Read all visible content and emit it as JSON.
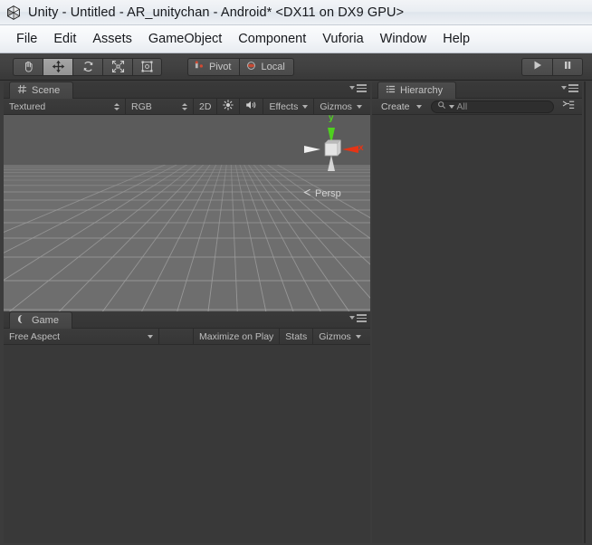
{
  "window": {
    "title": "Unity - Untitled - AR_unitychan - Android* <DX11 on DX9 GPU>",
    "logo_icon": "unity-logo-icon"
  },
  "menubar": {
    "items": [
      {
        "label": "File"
      },
      {
        "label": "Edit"
      },
      {
        "label": "Assets"
      },
      {
        "label": "GameObject"
      },
      {
        "label": "Component"
      },
      {
        "label": "Vuforia"
      },
      {
        "label": "Window"
      },
      {
        "label": "Help"
      }
    ]
  },
  "toolbar": {
    "transform_tools": [
      {
        "name": "hand-tool",
        "icon": "hand-icon",
        "active": false
      },
      {
        "name": "move-tool",
        "icon": "move-arrows-icon",
        "active": true
      },
      {
        "name": "rotate-tool",
        "icon": "rotate-icon",
        "active": false
      },
      {
        "name": "scale-tool",
        "icon": "scale-icon",
        "active": false
      },
      {
        "name": "rect-tool",
        "icon": "rect-transform-icon",
        "active": false
      }
    ],
    "pivot_label": "Pivot",
    "pivot_icon": "pivot-icon",
    "local_label": "Local",
    "local_icon": "local-rotation-icon",
    "play_icon": "play-icon",
    "pause_icon": "pause-icon"
  },
  "scene_panel": {
    "tab_label": "Scene",
    "tab_icon": "scene-grid-icon",
    "menu_icon": "panel-options-icon",
    "toolbar": {
      "draw_mode": "Textured",
      "render_mode": "RGB",
      "toggle_2d": "2D",
      "lighting_icon": "sun-light-icon",
      "audio_icon": "audio-speaker-icon",
      "effects_label": "Effects",
      "gizmos_label": "Gizmos"
    },
    "viewport": {
      "axis_gizmo": {
        "y_label": "y",
        "x_label": "x",
        "y_color": "#4fd01f",
        "x_color": "#e53415",
        "center_color": "#e4e4e4"
      },
      "projection_label": "Persp",
      "sky_color": "#5b5b5b",
      "ground_color": "#6e6e6e",
      "grid_color": "#8a8a8a"
    }
  },
  "game_panel": {
    "tab_label": "Game",
    "tab_icon": "game-view-icon",
    "menu_icon": "panel-options-icon",
    "toolbar": {
      "aspect": "Free Aspect",
      "maximize_label": "Maximize on Play",
      "stats_label": "Stats",
      "gizmos_label": "Gizmos"
    }
  },
  "hierarchy_panel": {
    "tab_label": "Hierarchy",
    "tab_icon": "hierarchy-list-icon",
    "menu_icon": "panel-options-icon",
    "create_label": "Create",
    "search_placeholder": "All",
    "search_icon": "search-icon",
    "sort_icon": "sort-alphabetical-icon",
    "items": []
  },
  "colors": {
    "window_chrome": "#eef1f5",
    "editor_bg": "#3c3c3c",
    "panel_bg": "#393939",
    "toolbar_bg": "#414141",
    "border": "#2b2b2b",
    "text": "#c3c3c3"
  }
}
